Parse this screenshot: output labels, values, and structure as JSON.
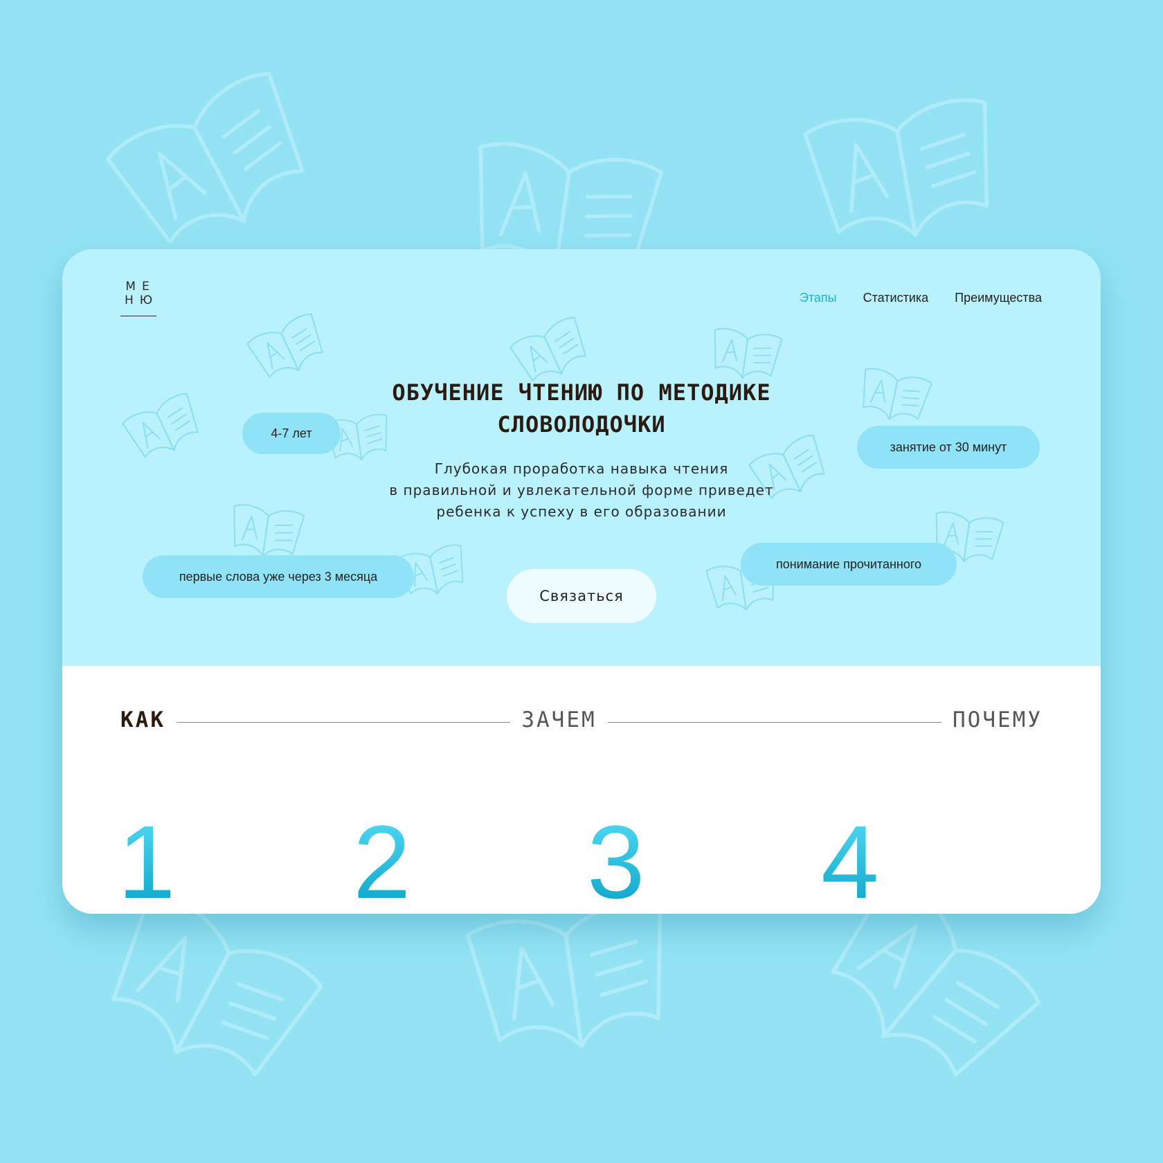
{
  "nav": {
    "menu_top": "МЕ",
    "menu_bottom": "НЮ",
    "items": [
      {
        "label": "Этапы",
        "active": true
      },
      {
        "label": "Статистика",
        "active": false
      },
      {
        "label": "Преимущества",
        "active": false
      }
    ]
  },
  "hero": {
    "title_line1": "ОБУЧЕНИЕ ЧТЕНИЮ ПО МЕТОДИКЕ",
    "title_line2": "СЛОВОЛОДОЧКИ",
    "description_line1": "Глубокая проработка навыка чтения",
    "description_line2": "в правильной и увлекательной форме приведет",
    "description_line3": "ребенка к успеху в его образовании",
    "cta_label": "Связаться",
    "tags": {
      "age": "4-7 лет",
      "duration": "занятие от 30 минут",
      "first_words": "первые слова уже через 3 месяца",
      "understanding": "понимание прочитанного"
    }
  },
  "sections": {
    "tabs": [
      {
        "label": "КАК",
        "active": true
      },
      {
        "label": "ЗАЧЕМ",
        "active": false
      },
      {
        "label": "ПОЧЕМУ",
        "active": false
      }
    ],
    "steps": [
      "1",
      "2",
      "3",
      "4"
    ]
  },
  "colors": {
    "page_bg": "#93e3f4",
    "hero_bg": "#b9f1fd",
    "pill_bg": "#90e2f6",
    "accent": "#1fb2cc",
    "cta_bg": "#effcff"
  }
}
